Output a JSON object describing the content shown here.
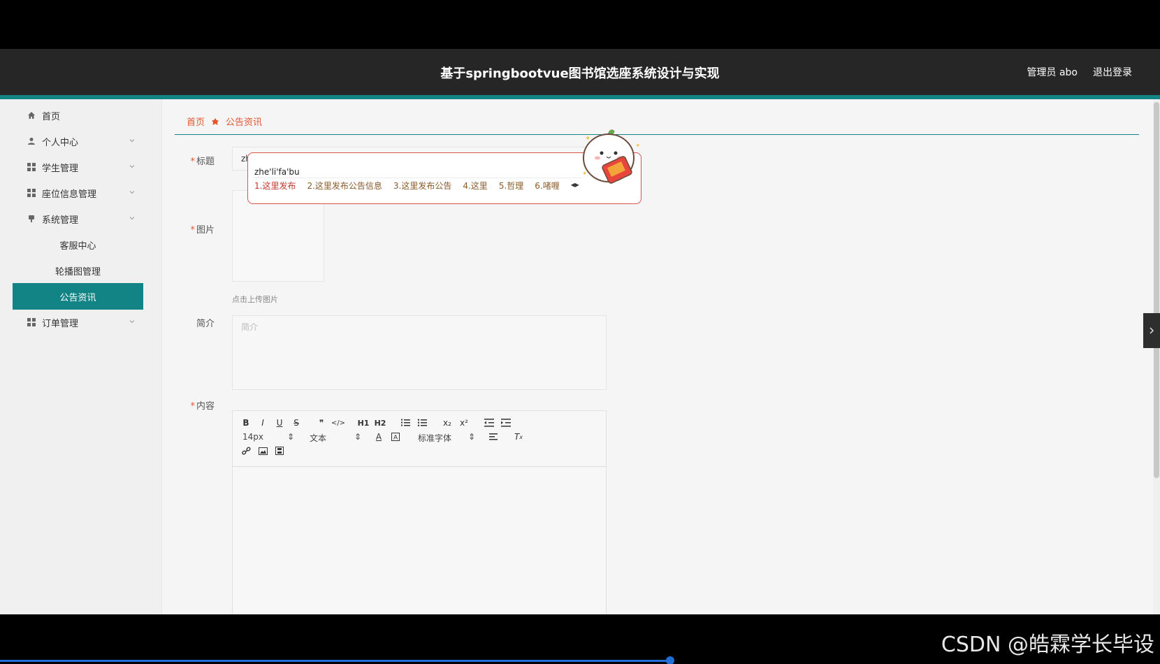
{
  "header": {
    "title": "基于springbootvue图书馆选座系统设计与实现",
    "user_label": "管理员 abo",
    "logout_label": "退出登录"
  },
  "sidebar": {
    "items": [
      {
        "label": "首页",
        "icon": "home-icon"
      },
      {
        "label": "个人中心",
        "icon": "user-icon"
      },
      {
        "label": "学生管理",
        "icon": "grid-icon"
      },
      {
        "label": "座位信息管理",
        "icon": "grid-icon"
      },
      {
        "label": "系统管理",
        "icon": "pin-icon"
      },
      {
        "label": "客服中心"
      },
      {
        "label": "轮播图管理"
      },
      {
        "label": "公告资讯"
      },
      {
        "label": "订单管理",
        "icon": "grid-icon"
      }
    ]
  },
  "breadcrumb": {
    "home": "首页",
    "current": "公告资讯"
  },
  "form": {
    "title_label": "标题",
    "title_value": "zhelifabu",
    "image_label": "图片",
    "upload_tip": "点击上传图片",
    "summary_label": "简介",
    "summary_placeholder": "简介",
    "content_label": "内容"
  },
  "editor": {
    "font_size": "14px",
    "block_format": "文本",
    "font_family": "标准字体",
    "buttons": [
      "B",
      "I",
      "U",
      "S",
      "❞",
      "</>",
      "H1",
      "H2",
      "ordered-list",
      "bullet-list",
      "x₂",
      "x²",
      "outdent",
      "indent",
      "text-color",
      "bg-color",
      "align",
      "clear-format",
      "link",
      "image",
      "video"
    ]
  },
  "ime": {
    "raw": "zhe'li'fa'bu",
    "candidates": [
      "1.这里发布",
      "2.这里发布公告信息",
      "3.这里发布公告",
      "4.这里",
      "5.哲理",
      "6.啫喱"
    ]
  },
  "watermark": "CSDN @皓霖学长毕设",
  "colors": {
    "accent": "#128485",
    "breadcrumb": "#e4572e",
    "header_bg": "#262626"
  }
}
